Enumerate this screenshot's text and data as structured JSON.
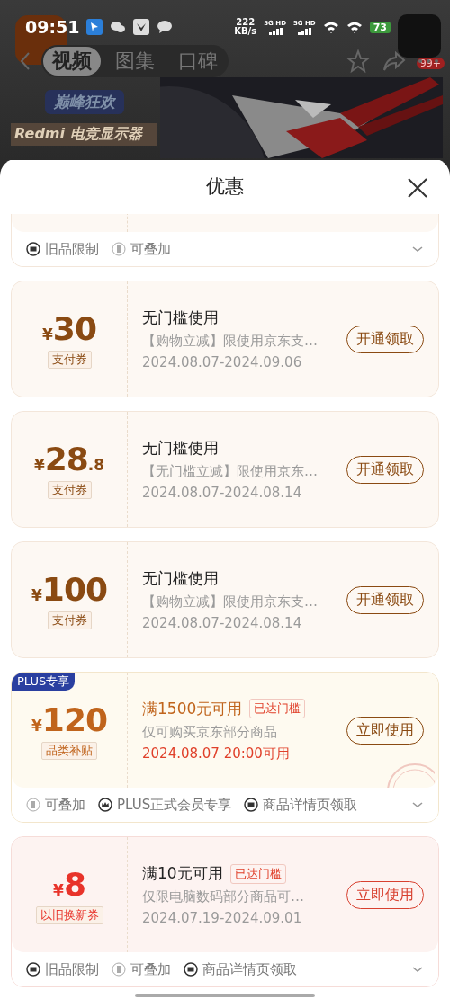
{
  "status_bar": {
    "time": "09:51",
    "speed": "222",
    "speed_unit": "KB/s",
    "networks": [
      "5G HD",
      "5G HD"
    ],
    "battery": "73"
  },
  "nav": {
    "tabs": [
      {
        "label": "视频",
        "selected": true
      },
      {
        "label": "图集",
        "selected": false
      },
      {
        "label": "口碑",
        "selected": false
      }
    ],
    "badge": "99+"
  },
  "banner": {
    "promo_title": "巅峰狂欢",
    "promo_text": "Redmi 电竞显示器"
  },
  "sheet": {
    "title": "优惠"
  },
  "coupons": [
    {
      "kind": "partial",
      "tags": [
        {
          "kind": "box",
          "label": "旧品限制"
        },
        {
          "kind": "stack",
          "label": "可叠加"
        }
      ]
    },
    {
      "kind": "pay",
      "currency": "¥",
      "amount": "30",
      "type_label": "支付券",
      "title": "无门槛使用",
      "desc": "【购物立减】限使用京东支…",
      "date": "2024.08.07-2024.09.06",
      "button": "开通领取"
    },
    {
      "kind": "pay",
      "currency": "¥",
      "amount": "28",
      "decimal": ".8",
      "type_label": "支付券",
      "title": "无门槛使用",
      "desc": "【无门槛立减】限使用京东…",
      "date": "2024.08.07-2024.08.14",
      "button": "开通领取"
    },
    {
      "kind": "pay",
      "currency": "¥",
      "amount": "100",
      "type_label": "支付券",
      "title": "无门槛使用",
      "desc": "【购物立减】限使用京东支…",
      "date": "2024.08.07-2024.08.14",
      "button": "开通领取"
    },
    {
      "kind": "plus",
      "ribbon": "PLUS专享",
      "currency": "¥",
      "amount": "120",
      "type_label": "品类补贴",
      "title": "满1500元可用",
      "title_badge": "已达门槛",
      "desc": "仅可购买京东部分商品",
      "date": "2024.08.07 20:00可用",
      "button": "立即使用",
      "claimed": true,
      "tags": [
        {
          "kind": "stack",
          "label": "可叠加"
        },
        {
          "kind": "crown",
          "label": "PLUS正式会员专享"
        },
        {
          "kind": "box",
          "label": "商品详情页领取"
        }
      ]
    },
    {
      "kind": "trade",
      "currency": "¥",
      "amount": "8",
      "type_label": "以旧换新券",
      "title": "满10元可用",
      "title_badge": "已达门槛",
      "desc": "仅限电脑数码部分商品可…",
      "date": "2024.07.19-2024.09.01",
      "button": "立即使用",
      "tags": [
        {
          "kind": "box",
          "label": "旧品限制"
        },
        {
          "kind": "stack",
          "label": "可叠加"
        },
        {
          "kind": "box",
          "label": "商品详情页领取"
        }
      ]
    }
  ]
}
